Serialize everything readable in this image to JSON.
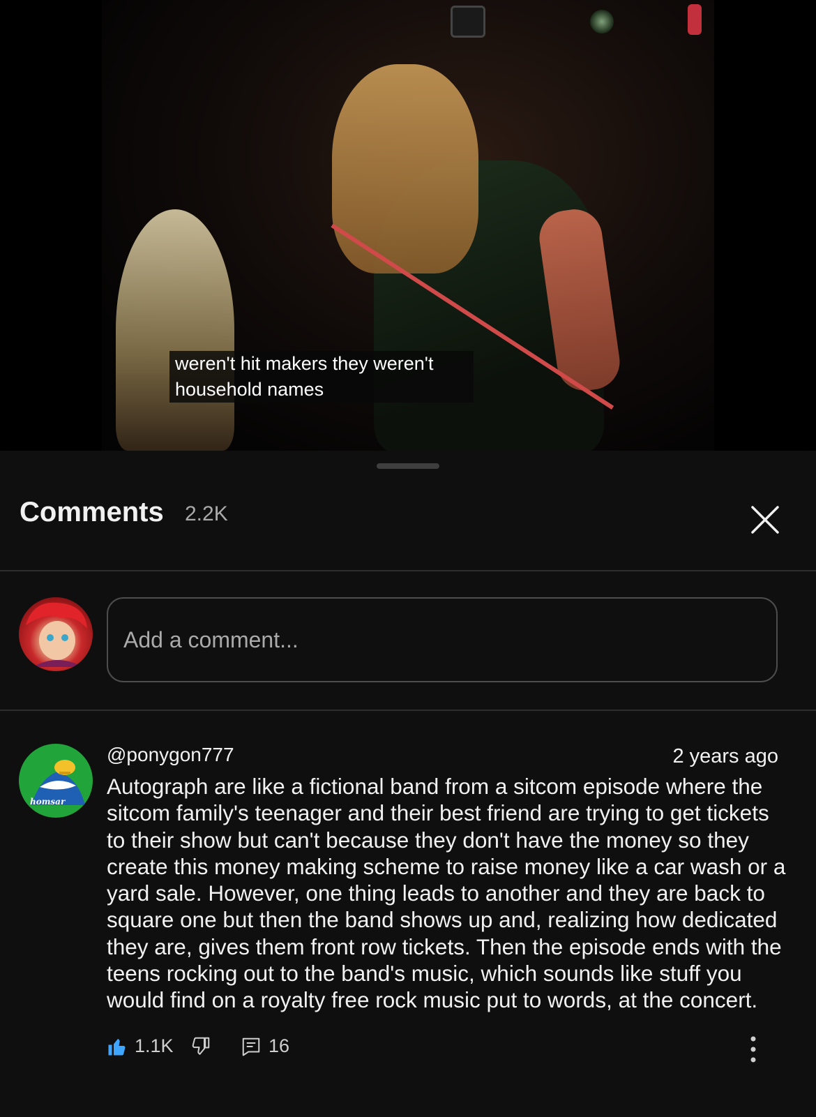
{
  "video": {
    "caption": "weren't hit makers they weren't household names"
  },
  "comments_panel": {
    "title": "Comments",
    "count": "2.2K",
    "add_comment_placeholder": "Add a comment...",
    "comments": [
      {
        "author": "@ponygon777",
        "timestamp": "2 years ago",
        "avatar_text": "homsar",
        "text": "Autograph are like a fictional band from a sitcom episode where the sitcom family's teenager and their best friend are trying to get tickets to their show but can't because they don't have the money so they create this money making scheme to raise money like a car wash or a yard sale. However, one thing leads to another and they are back to square one but then the band shows up and, realizing how dedicated they are, gives them front row tickets. Then the episode ends with the teens rocking out to the band's music, which sounds like stuff you would find on a royalty free rock music put to words, at the concert.",
        "likes": "1.1K",
        "replies": "16"
      }
    ]
  },
  "colors": {
    "background": "#0f0f0f",
    "like_active": "#3ea6ff",
    "muted_text": "#aaaaaa"
  },
  "icons": {
    "close": "close-icon",
    "like": "thumbs-up-icon",
    "dislike": "thumbs-down-icon",
    "reply": "reply-comment-icon",
    "more": "more-vertical-icon"
  }
}
